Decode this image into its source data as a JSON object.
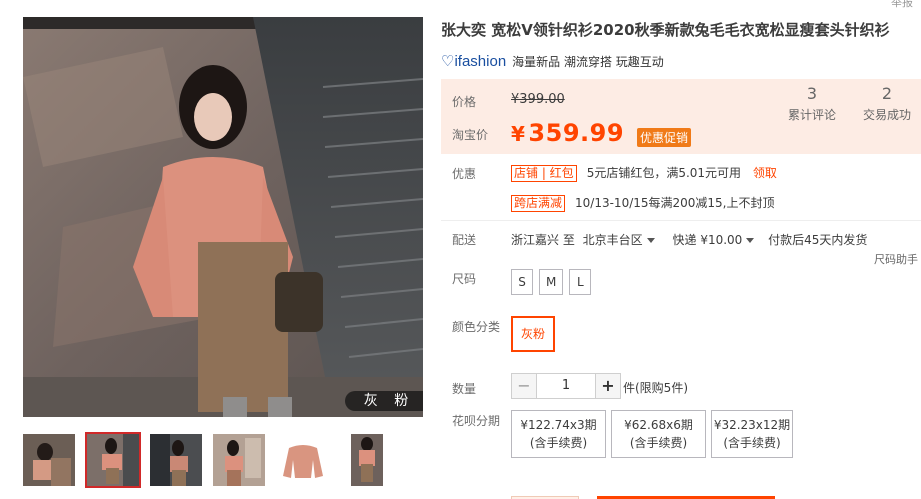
{
  "header": {
    "report": "举报"
  },
  "product": {
    "title": "张大奕 宽松V领针织衫2020秋季新款兔毛毛衣宽松显瘦套头针织衫",
    "brand_logo": "ifashion",
    "brand_tags": "海量新品 潮流穿搭 玩趣互动"
  },
  "price": {
    "label_price": "价格",
    "original": "¥399.00",
    "label_tb": "淘宝价",
    "yen": "¥",
    "current": "359.99",
    "promo": "优惠促销",
    "reviews_num": "3",
    "reviews_label": "累计评论",
    "deals_num": "2",
    "deals_label": "交易成功"
  },
  "promotion": {
    "label": "优惠",
    "coupon_tag": "店铺 | 红包",
    "coupon_text": "5元店铺红包，满5.01元可用",
    "coupon_link": "领取",
    "discount_tag": "跨店满减",
    "discount_text": "10/13-10/15每满200减15,上不封顶"
  },
  "delivery": {
    "label": "配送",
    "from": "浙江嘉兴 至",
    "to": "北京丰台区",
    "express": "快递 ¥10.00",
    "pay": "付款后45天内发货",
    "size_helper": "尺码助手"
  },
  "size": {
    "label": "尺码",
    "options": [
      "S",
      "M",
      "L"
    ]
  },
  "color": {
    "label": "颜色分类",
    "selected": "灰粉"
  },
  "quantity": {
    "label": "数量",
    "minus": "−",
    "value": "1",
    "plus": "+",
    "stock": "件(限购5件)"
  },
  "installment": {
    "label": "花呗分期",
    "options": [
      {
        "amount": "¥122.74x3期",
        "fee": "(含手续费)"
      },
      {
        "amount": "¥62.68x6期",
        "fee": "(含手续费)"
      },
      {
        "amount": "¥32.23x12期",
        "fee": "(含手续费)"
      }
    ]
  },
  "gallery": {
    "overlay_color": "灰 粉"
  },
  "colors": {
    "accent": "#ff4400",
    "price_bg": "#fdece4",
    "brand": "#1a4fa0"
  }
}
